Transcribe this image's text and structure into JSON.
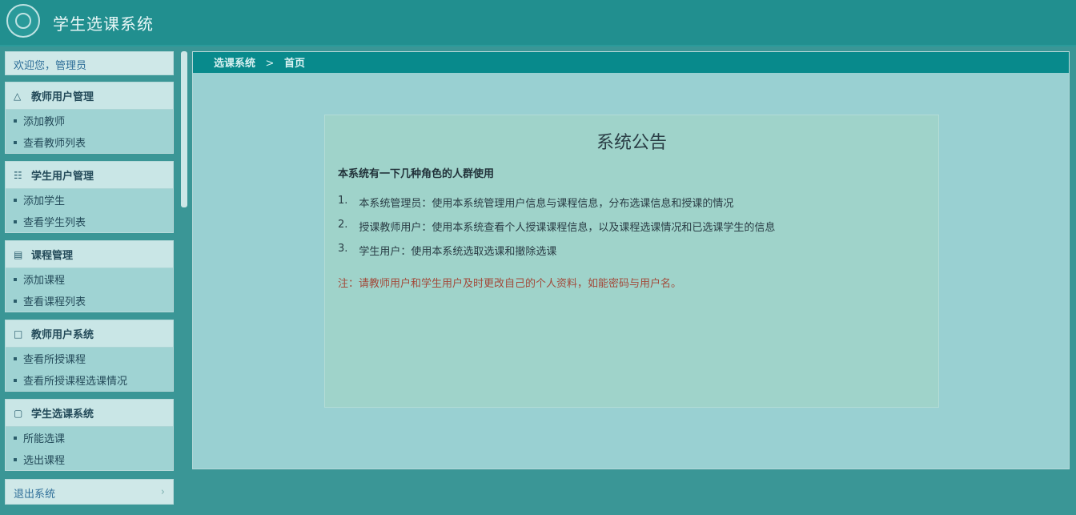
{
  "app": {
    "title": "学生选课系统"
  },
  "sidebar": {
    "welcome": "欢迎您，管理员",
    "groups": [
      {
        "title": "教师用户管理",
        "icon": "user-icon",
        "items": [
          "添加教师",
          "查看教师列表"
        ]
      },
      {
        "title": "学生用户管理",
        "icon": "students-icon",
        "items": [
          "添加学生",
          "查看学生列表"
        ]
      },
      {
        "title": "课程管理",
        "icon": "book-icon",
        "items": [
          "添加课程",
          "查看课程列表"
        ]
      },
      {
        "title": "教师用户系统",
        "icon": "calendar-icon",
        "items": [
          "查看所授课程",
          "查看所授课程选课情况"
        ]
      },
      {
        "title": "学生选课系统",
        "icon": "chat-icon",
        "items": [
          "所能选课",
          "选出课程"
        ]
      }
    ],
    "logout": "退出系统"
  },
  "main": {
    "breadcrumb": [
      "选课系统",
      "首页"
    ],
    "notice": {
      "title": "系统公告",
      "intro": "本系统有一下几种角色的人群使用",
      "items": [
        "本系统管理员：使用本系统管理用户信息与课程信息，分布选课信息和授课的情况",
        "授课教师用户：使用本系统查看个人授课课程信息，以及课程选课情况和已选课学生的信息",
        "学生用户：使用本系统选取选课和撤除选课"
      ],
      "note": "注：请教师用户和学生用户及时更改自己的个人资料，如能密码与用户名。"
    }
  }
}
